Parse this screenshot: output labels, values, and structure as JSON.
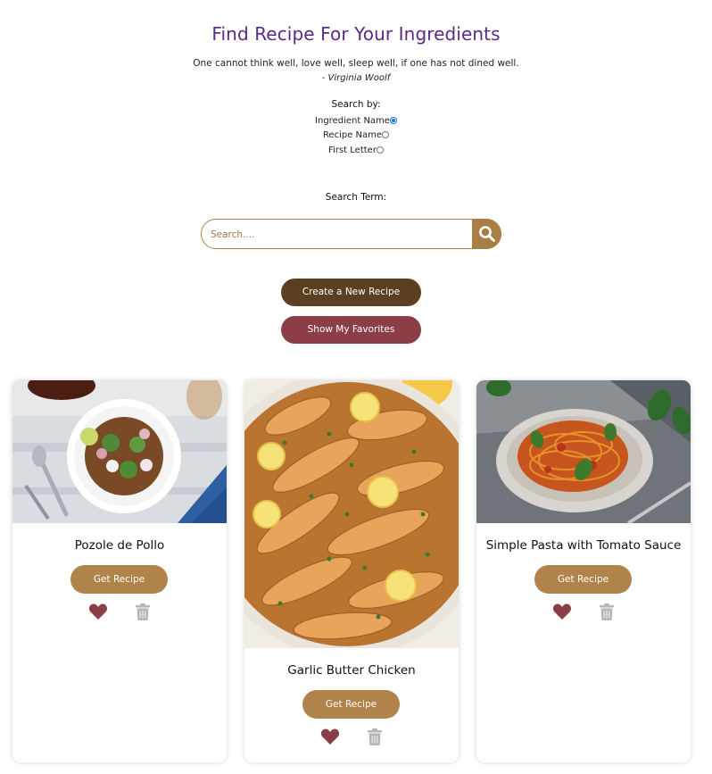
{
  "header": {
    "title": "Find Recipe For Your Ingredients",
    "quote": "One cannot think well, love well, sleep well, if one has not dined well.",
    "author_dash": "- ",
    "author_name": "Virginia Woolf"
  },
  "search_options": {
    "label": "Search by:",
    "options": [
      {
        "label": "Ingredient Name",
        "checked": true
      },
      {
        "label": "Recipe Name",
        "checked": false
      },
      {
        "label": "First Letter",
        "checked": false
      }
    ]
  },
  "search": {
    "label": "Search Term:",
    "placeholder": "Search....",
    "value": ""
  },
  "actions": {
    "create_label": "Create a New Recipe",
    "favorites_label": "Show My Favorites"
  },
  "cards": [
    {
      "title": "Pozole de Pollo",
      "button_label": "Get Recipe",
      "favorite": true
    },
    {
      "title": "Garlic Butter Chicken",
      "button_label": "Get Recipe",
      "favorite": true
    },
    {
      "title": "Simple Pasta with Tomato Sauce",
      "button_label": "Get Recipe",
      "favorite": true
    }
  ],
  "icons": {
    "search": "search-icon",
    "heart": "heart-icon",
    "trash": "trash-icon"
  },
  "colors": {
    "title": "#5a2a86",
    "create_button": "#5a4020",
    "favorites_button": "#8b3e46",
    "get_recipe_button": "#b0834a",
    "heart": "#8b3e46",
    "trash": "#b5b5b5",
    "radio_selected": "#1a73e8"
  }
}
